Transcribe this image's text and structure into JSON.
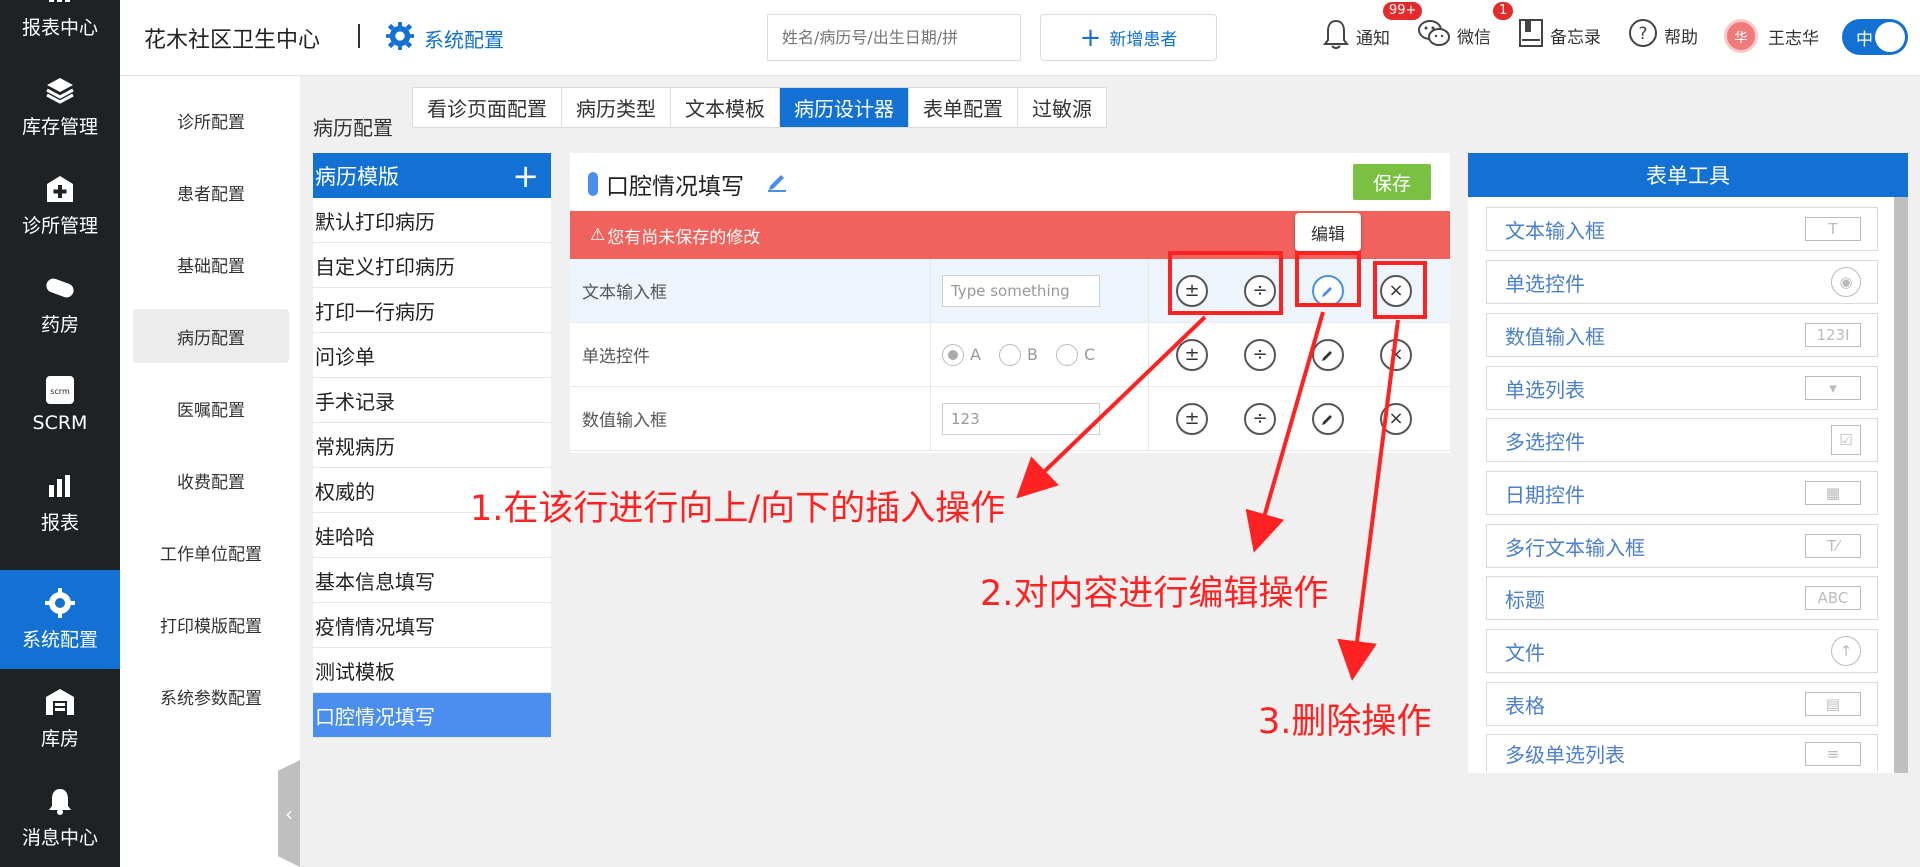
{
  "nav": [
    {
      "name": "nav-reports-center",
      "icon": "bar-chart-icon",
      "label": "报表中心"
    },
    {
      "name": "nav-inventory",
      "icon": "layers-icon",
      "label": "库存管理"
    },
    {
      "name": "nav-clinic",
      "icon": "medical-plus-icon",
      "label": "诊所管理"
    },
    {
      "name": "nav-pharmacy",
      "icon": "pill-icon",
      "label": "药房"
    },
    {
      "name": "nav-scrm",
      "icon": "scrm-icon",
      "label": "SCRM"
    },
    {
      "name": "nav-reports",
      "icon": "bar-chart-icon",
      "label": "报表"
    },
    {
      "name": "nav-system",
      "icon": "gear-icon",
      "label": "系统配置",
      "active": true
    },
    {
      "name": "nav-warehouse",
      "icon": "warehouse-icon",
      "label": "库房"
    },
    {
      "name": "nav-messages",
      "icon": "bell-icon",
      "label": "消息中心"
    }
  ],
  "header": {
    "clinic_name": "花木社区卫生中心",
    "breadcrumb": "系统配置",
    "search_placeholder": "姓名/病历号/出生日期/拼",
    "add_patient": "新增患者",
    "notify": {
      "label": "通知",
      "badge": "99+"
    },
    "wechat": {
      "label": "微信",
      "badge": "1"
    },
    "memo": "备忘录",
    "help": "帮助",
    "user": {
      "avatar": "华",
      "name": "王志华"
    },
    "lang_toggle": "中"
  },
  "sub_nav": [
    "诊所配置",
    "患者配置",
    "基础配置",
    "病历配置",
    "医嘱配置",
    "收费配置",
    "工作单位配置",
    "打印模版配置",
    "系统参数配置"
  ],
  "section_title": "病历配置",
  "tabs": [
    "看诊页面配置",
    "病历类型",
    "文本模板",
    "病历设计器",
    "表单配置",
    "过敏源"
  ],
  "templates": {
    "header": "病历模版",
    "items": [
      "默认打印病历",
      "自定义打印病历",
      "打印一行病历",
      "问诊单",
      "手术记录",
      "常规病历",
      "权威的",
      "娃哈哈",
      "基本信息填写",
      "疫情情况填写",
      "测试模板",
      "口腔情况填写"
    ]
  },
  "editor": {
    "title": "口腔情况填写",
    "save": "保存",
    "warning": "您有尚未保存的修改",
    "tooltip": "编辑",
    "rows": [
      {
        "label": "文本输入框",
        "placeholder": "Type something"
      },
      {
        "label": "单选控件",
        "options": [
          "A",
          "B",
          "C"
        ]
      },
      {
        "label": "数值输入框",
        "value": "123"
      }
    ]
  },
  "annotations": [
    "1.在该行进行向上/向下的插入操作",
    "2.对内容进行编辑操作",
    "3.删除操作"
  ],
  "tools": {
    "header": "表单工具",
    "items": [
      {
        "label": "文本输入框",
        "icon": "T"
      },
      {
        "label": "单选控件",
        "icon": "◉"
      },
      {
        "label": "数值输入框",
        "icon": "123I"
      },
      {
        "label": "单选列表",
        "icon": "▾"
      },
      {
        "label": "多选控件",
        "icon": "☑"
      },
      {
        "label": "日期控件",
        "icon": "▦"
      },
      {
        "label": "多行文本输入框",
        "icon": "T⁄"
      },
      {
        "label": "标题",
        "icon": "ABC"
      },
      {
        "label": "文件",
        "icon": "↑"
      },
      {
        "label": "表格",
        "icon": "▤"
      },
      {
        "label": "多级单选列表",
        "icon": "≡"
      }
    ]
  },
  "colors": {
    "primary": "#1271d3",
    "warning": "#f2625c",
    "save": "#7ac143",
    "annotation": "#ff2222"
  }
}
